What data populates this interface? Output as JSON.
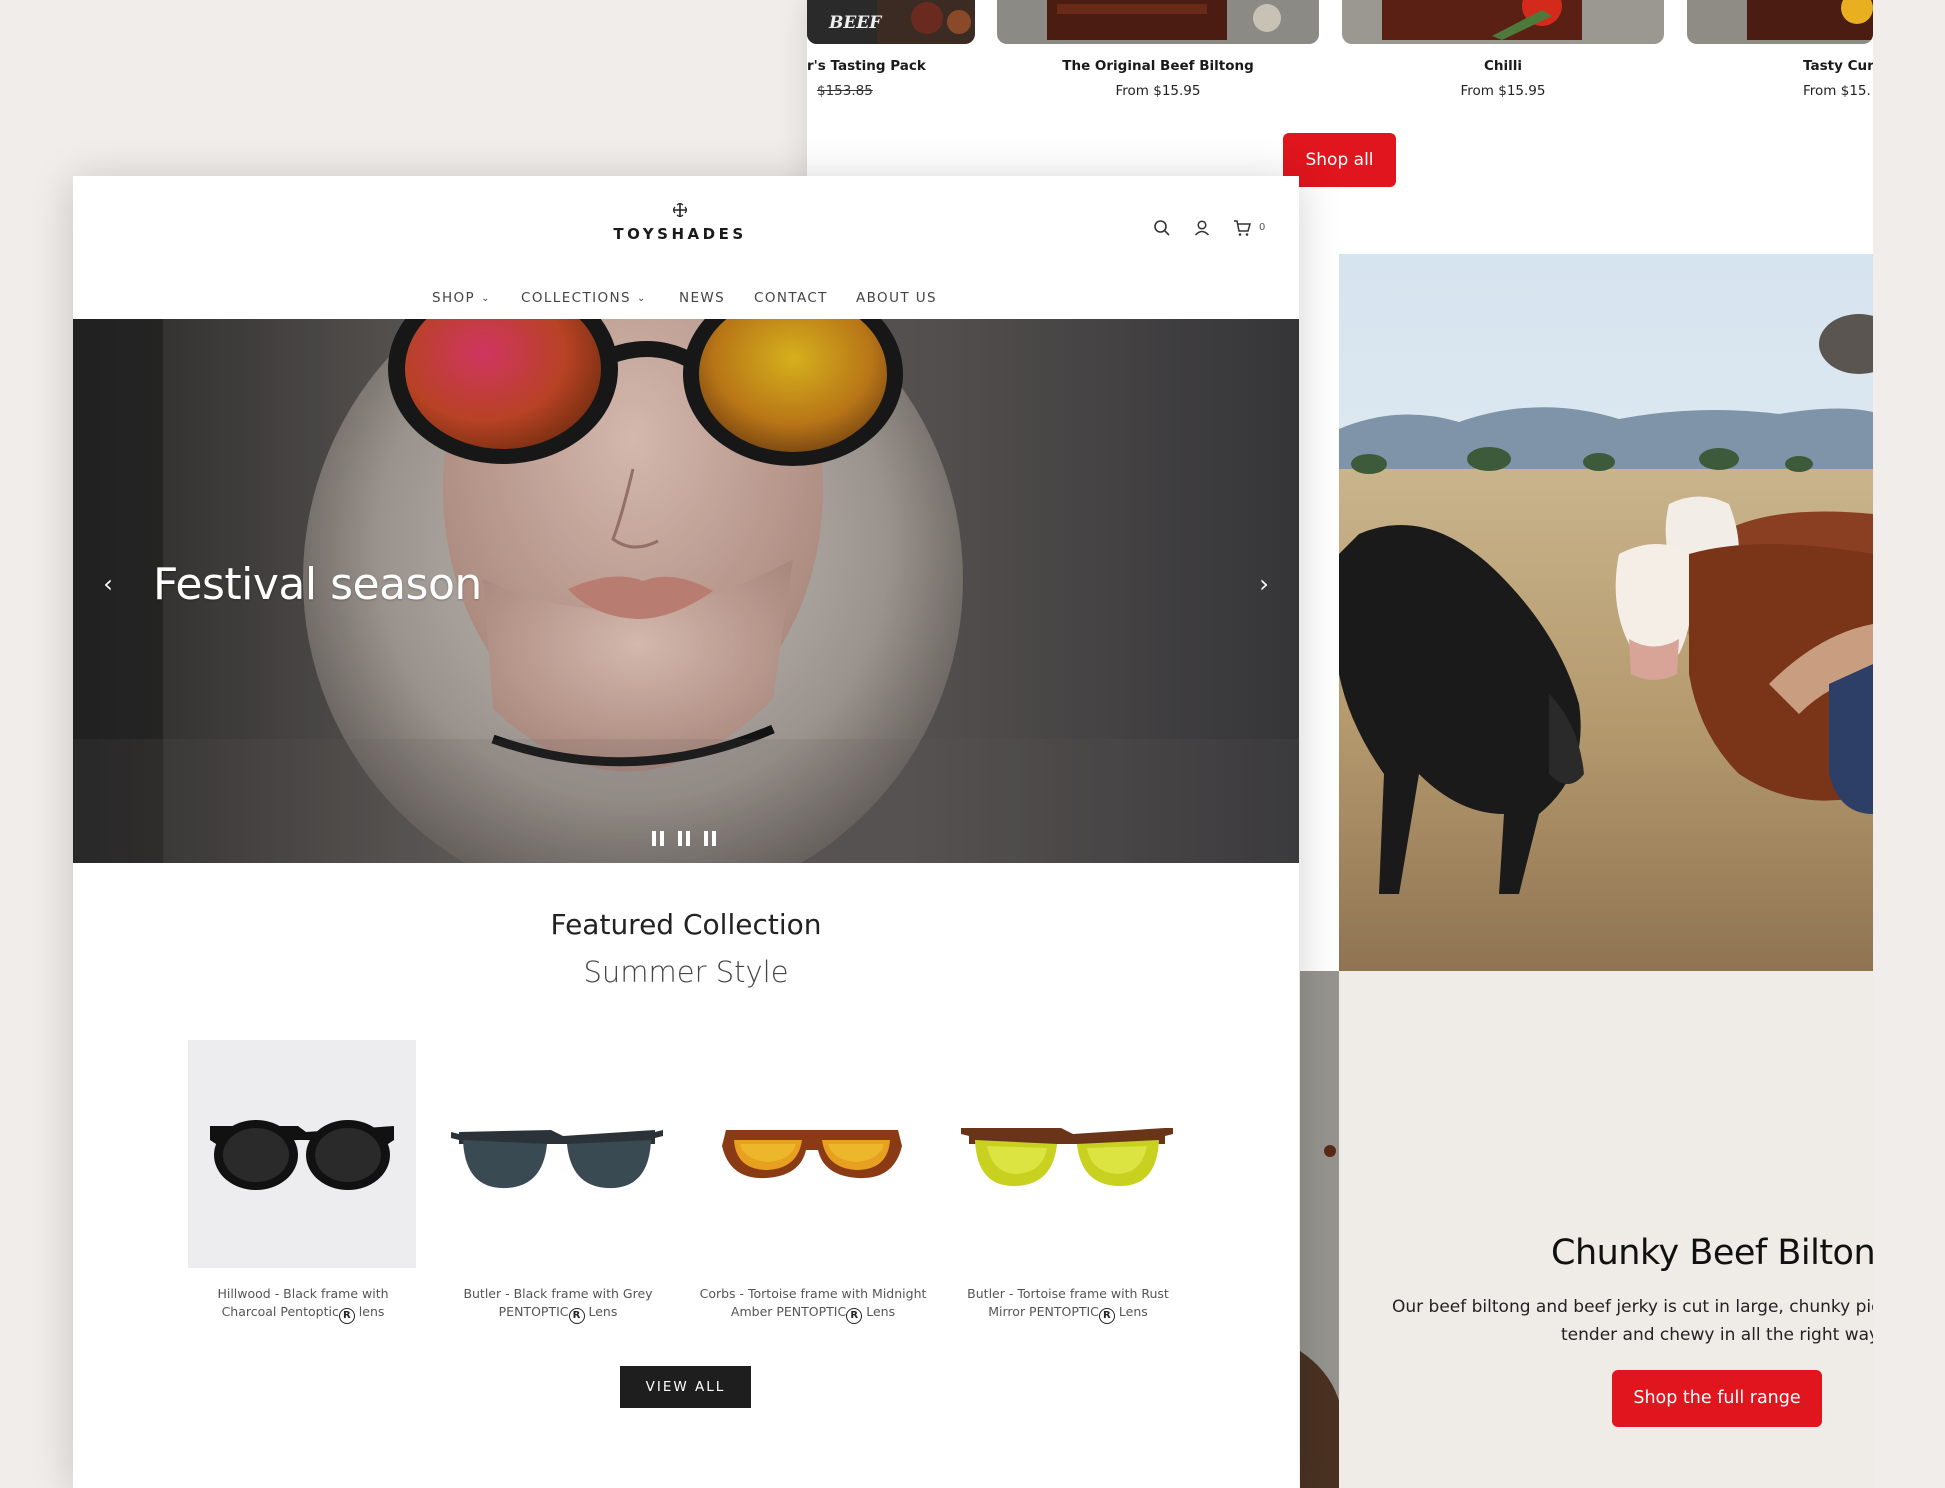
{
  "back_store": {
    "products": [
      {
        "name": "r's Tasting Pack",
        "price": "$153.85",
        "strikethrough": true
      },
      {
        "name": "The Original Beef Biltong",
        "price": "From $15.95",
        "strikethrough": false
      },
      {
        "name": "Chilli",
        "price": "From $15.95",
        "strikethrough": false
      },
      {
        "name": "Tasty Cur",
        "price": "From $15.",
        "strikethrough": false
      }
    ],
    "thumb_label": "BEEF",
    "shop_all_label": "Shop all",
    "feature": {
      "title": "Chunky Beef Biltong",
      "text_line1": "Our beef biltong and beef jerky is cut in large, chunky piece",
      "text_line2": "tender and chewy in all the right ways.",
      "button_label": "Shop the full range"
    },
    "accent_color": "#e0151d"
  },
  "front_store": {
    "brand": "TOYSHADES",
    "header_icons": [
      "search-icon",
      "user-icon",
      "cart-icon"
    ],
    "cart_count": "0",
    "nav": [
      {
        "label": "SHOP",
        "dropdown": true
      },
      {
        "label": "COLLECTIONS",
        "dropdown": true
      },
      {
        "label": "NEWS",
        "dropdown": false
      },
      {
        "label": "CONTACT",
        "dropdown": false
      },
      {
        "label": "ABOUT US",
        "dropdown": false
      }
    ],
    "hero": {
      "title": "Festival season",
      "prev_arrow": "‹",
      "next_arrow": "›",
      "slide_count": 3,
      "active_slide": 1
    },
    "featured": {
      "title": "Featured Collection",
      "subtitle": "Summer Style",
      "products": [
        {
          "name_line1": "Hillwood - Black frame with",
          "name_line2a": "Charcoal Pentoptic",
          "name_line2b": " lens"
        },
        {
          "name_line1": "Butler - Black frame with Grey",
          "name_line2a": "PENTOPTIC",
          "name_line2b": " Lens"
        },
        {
          "name_line1": "Corbs - Tortoise frame with Midnight",
          "name_line2a": "Amber PENTOPTIC",
          "name_line2b": " Lens"
        },
        {
          "name_line1": "Butler - Tortoise frame with Rust",
          "name_line2a": "Mirror PENTOPTIC",
          "name_line2b": " Lens"
        }
      ],
      "registered_mark": "R",
      "view_all_label": "VIEW ALL"
    }
  }
}
